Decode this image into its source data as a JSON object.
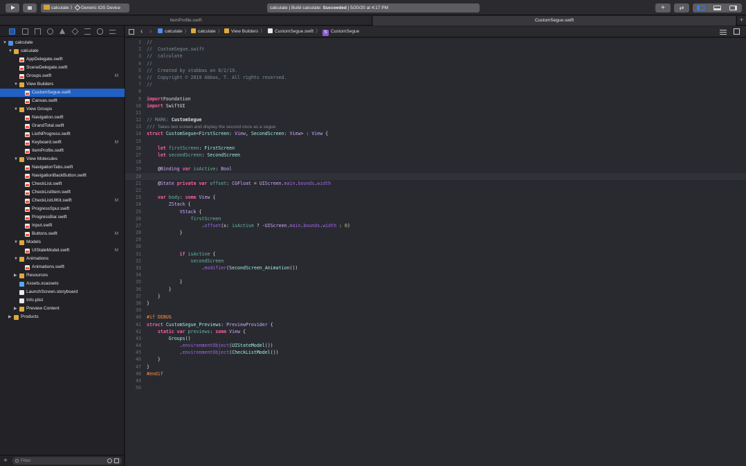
{
  "toolbar": {
    "scheme": "calculate",
    "destination": "Generic iOS Device",
    "activity_prefix": "calculate | Build calculate: ",
    "activity_status": "Succeeded",
    "activity_time": " | 5/20/20 at 4:17 PM",
    "add_label": "+",
    "swap_label": "⇄"
  },
  "tabs": [
    {
      "label": "ItemProfile.swift"
    },
    {
      "label": "CustomSegue.swift"
    }
  ],
  "tab_add": "+",
  "navigator": {
    "filter_placeholder": "Filter",
    "add_label": "+",
    "tree": [
      {
        "label": "calculate",
        "icon": "proj",
        "depth": 0,
        "disclosure": "▼",
        "badge": ""
      },
      {
        "label": "calculate",
        "icon": "folder",
        "depth": 1,
        "disclosure": "▼",
        "badge": ""
      },
      {
        "label": "AppDelegate.swift",
        "icon": "swift",
        "depth": 2,
        "disclosure": "",
        "badge": ""
      },
      {
        "label": "SceneDelegate.swift",
        "icon": "swift",
        "depth": 2,
        "disclosure": "",
        "badge": ""
      },
      {
        "label": "Groups.swift",
        "icon": "swift",
        "depth": 2,
        "disclosure": "",
        "badge": "M"
      },
      {
        "label": "View Builders",
        "icon": "folder",
        "depth": 2,
        "disclosure": "▼",
        "badge": ""
      },
      {
        "label": "CustomSegue.swift",
        "icon": "swift",
        "depth": 3,
        "disclosure": "",
        "badge": "",
        "selected": true
      },
      {
        "label": "Canvas.swift",
        "icon": "swift",
        "depth": 3,
        "disclosure": "",
        "badge": ""
      },
      {
        "label": "View Groups",
        "icon": "folder",
        "depth": 2,
        "disclosure": "▼",
        "badge": ""
      },
      {
        "label": "Navigation.swift",
        "icon": "swift",
        "depth": 3,
        "disclosure": "",
        "badge": ""
      },
      {
        "label": "GrandTotal.swift",
        "icon": "swift",
        "depth": 3,
        "disclosure": "",
        "badge": ""
      },
      {
        "label": "ListNProgress.swift",
        "icon": "swift",
        "depth": 3,
        "disclosure": "",
        "badge": ""
      },
      {
        "label": "Keyboard.swift",
        "icon": "swift",
        "depth": 3,
        "disclosure": "",
        "badge": "M"
      },
      {
        "label": "ItemProfile.swift",
        "icon": "swift",
        "depth": 3,
        "disclosure": "",
        "badge": ""
      },
      {
        "label": "View Molecules",
        "icon": "folder",
        "depth": 2,
        "disclosure": "▼",
        "badge": ""
      },
      {
        "label": "NavigationTabs.swift",
        "icon": "swift",
        "depth": 3,
        "disclosure": "",
        "badge": ""
      },
      {
        "label": "NavigationBackButton.swift",
        "icon": "swift",
        "depth": 3,
        "disclosure": "",
        "badge": ""
      },
      {
        "label": "CheckList.swift",
        "icon": "swift",
        "depth": 3,
        "disclosure": "",
        "badge": ""
      },
      {
        "label": "CheckListItem.swift",
        "icon": "swift",
        "depth": 3,
        "disclosure": "",
        "badge": ""
      },
      {
        "label": "CheckListUIKit.swift",
        "icon": "swift",
        "depth": 3,
        "disclosure": "",
        "badge": "M"
      },
      {
        "label": "ProgressSpur.swift",
        "icon": "swift",
        "depth": 3,
        "disclosure": "",
        "badge": ""
      },
      {
        "label": "ProgressBar.swift",
        "icon": "swift",
        "depth": 3,
        "disclosure": "",
        "badge": ""
      },
      {
        "label": "Input.swift",
        "icon": "swift",
        "depth": 3,
        "disclosure": "",
        "badge": ""
      },
      {
        "label": "Buttons.swift",
        "icon": "swift",
        "depth": 3,
        "disclosure": "",
        "badge": "M"
      },
      {
        "label": "Models",
        "icon": "folder",
        "depth": 2,
        "disclosure": "▼",
        "badge": ""
      },
      {
        "label": "UIStateModel.swift",
        "icon": "swift",
        "depth": 3,
        "disclosure": "",
        "badge": "M"
      },
      {
        "label": "Animations",
        "icon": "folder",
        "depth": 2,
        "disclosure": "▼",
        "badge": ""
      },
      {
        "label": "Animations.swift",
        "icon": "swift",
        "depth": 3,
        "disclosure": "",
        "badge": ""
      },
      {
        "label": "Resources",
        "icon": "folder",
        "depth": 2,
        "disclosure": "▶",
        "badge": ""
      },
      {
        "label": "Assets.xcassets",
        "icon": "assets",
        "depth": 2,
        "disclosure": "",
        "badge": ""
      },
      {
        "label": "LaunchScreen.storyboard",
        "icon": "file",
        "depth": 2,
        "disclosure": "",
        "badge": ""
      },
      {
        "label": "Info.plist",
        "icon": "file",
        "depth": 2,
        "disclosure": "",
        "badge": ""
      },
      {
        "label": "Preview Content",
        "icon": "folder",
        "depth": 2,
        "disclosure": "▶",
        "badge": ""
      },
      {
        "label": "Products",
        "icon": "folder",
        "depth": 1,
        "disclosure": "▶",
        "badge": ""
      }
    ]
  },
  "jumpbar": {
    "crumbs": [
      {
        "label": "calculate",
        "icon": "proj"
      },
      {
        "label": "calculate",
        "icon": "folder"
      },
      {
        "label": "View Builders",
        "icon": "folder"
      },
      {
        "label": "CustomSegue.swift",
        "icon": "swift"
      },
      {
        "label": "CustomSegue",
        "icon": "struct"
      }
    ],
    "struct_glyph": "S"
  },
  "editor": {
    "current_line": 20,
    "lines": [
      [
        [
          "cm",
          "//"
        ]
      ],
      [
        [
          "cm",
          "//  CustomSegue.swift"
        ]
      ],
      [
        [
          "cm",
          "//  calculate"
        ]
      ],
      [
        [
          "cm",
          "//"
        ]
      ],
      [
        [
          "cm",
          "//  Created by xtabbas on 8/2/19."
        ]
      ],
      [
        [
          "cm",
          "//  Copyright © 2019 Abbas, T. All rights reserved."
        ]
      ],
      [
        [
          "cm",
          "//"
        ]
      ],
      [],
      [
        [
          "kw",
          "import"
        ],
        [
          "",
          "Foundation"
        ]
      ],
      [
        [
          "kw",
          "import"
        ],
        [
          "",
          " SwiftUI"
        ]
      ],
      [],
      [
        [
          "cm",
          "// MARK: "
        ],
        [
          "mk",
          "CustomSegue"
        ]
      ],
      [
        [
          "cm",
          "/// "
        ],
        [
          "dc",
          "Takes two screen and display the second once as a segue"
        ]
      ],
      [
        [
          "kw",
          "struct"
        ],
        [
          "",
          " "
        ],
        [
          "pj",
          "CustomSegue"
        ],
        [
          "",
          "<"
        ],
        [
          "pj",
          "FirstScreen"
        ],
        [
          "",
          ": "
        ],
        [
          "ty",
          "View"
        ],
        [
          "",
          ", "
        ],
        [
          "pj",
          "SecondScreen"
        ],
        [
          "",
          ": "
        ],
        [
          "ty",
          "View"
        ],
        [
          "",
          "> : "
        ],
        [
          "ty",
          "View"
        ],
        [
          "",
          " {"
        ]
      ],
      [],
      [
        [
          "",
          "    "
        ],
        [
          "kw",
          "let"
        ],
        [
          "",
          " "
        ],
        [
          "pt",
          "firstScreen"
        ],
        [
          "",
          ": "
        ],
        [
          "pj",
          "FirstScreen"
        ]
      ],
      [
        [
          "",
          "    "
        ],
        [
          "kw",
          "let"
        ],
        [
          "",
          " "
        ],
        [
          "pt",
          "secondScreen"
        ],
        [
          "",
          ": "
        ],
        [
          "pj",
          "SecondScreen"
        ]
      ],
      [],
      [
        [
          "",
          "    @"
        ],
        [
          "ty",
          "Binding"
        ],
        [
          "",
          " "
        ],
        [
          "kw",
          "var"
        ],
        [
          "",
          " "
        ],
        [
          "pt",
          "isActive"
        ],
        [
          "",
          ": "
        ],
        [
          "ty",
          "Bool"
        ]
      ],
      [],
      [
        [
          "",
          "    @"
        ],
        [
          "ty",
          "State"
        ],
        [
          "",
          " "
        ],
        [
          "kw",
          "private var"
        ],
        [
          "",
          " "
        ],
        [
          "pt",
          "offset"
        ],
        [
          "",
          ": "
        ],
        [
          "ty",
          "CGFloat"
        ],
        [
          "",
          " = "
        ],
        [
          "ty",
          "UIScreen"
        ],
        [
          "",
          "."
        ],
        [
          "fn",
          "main"
        ],
        [
          "",
          "."
        ],
        [
          "fn",
          "bounds"
        ],
        [
          "",
          "."
        ],
        [
          "fn",
          "width"
        ]
      ],
      [],
      [
        [
          "",
          "    "
        ],
        [
          "kw",
          "var"
        ],
        [
          "",
          " "
        ],
        [
          "pt",
          "body"
        ],
        [
          "",
          ": "
        ],
        [
          "kw",
          "some"
        ],
        [
          "",
          " "
        ],
        [
          "ty",
          "View"
        ],
        [
          "",
          " {"
        ]
      ],
      [
        [
          "",
          "        "
        ],
        [
          "ty",
          "ZStack"
        ],
        [
          "",
          " {"
        ]
      ],
      [
        [
          "",
          "            "
        ],
        [
          "ty",
          "VStack"
        ],
        [
          "",
          " {"
        ]
      ],
      [
        [
          "",
          "                "
        ],
        [
          "pt",
          "firstScreen"
        ]
      ],
      [
        [
          "",
          "                    ."
        ],
        [
          "fn",
          "offset"
        ],
        [
          "",
          "(x: "
        ],
        [
          "pt",
          "isActive"
        ],
        [
          "",
          " ? -"
        ],
        [
          "ty",
          "UIScreen"
        ],
        [
          "",
          "."
        ],
        [
          "fn",
          "main"
        ],
        [
          "",
          "."
        ],
        [
          "fn",
          "bounds"
        ],
        [
          "",
          "."
        ],
        [
          "fn",
          "width"
        ],
        [
          "",
          " : "
        ],
        [
          "nm",
          "0"
        ],
        [
          "",
          ")"
        ]
      ],
      [
        [
          "",
          "            }"
        ]
      ],
      [],
      [],
      [
        [
          "",
          "            "
        ],
        [
          "kw",
          "if"
        ],
        [
          "",
          " "
        ],
        [
          "pt",
          "isActive"
        ],
        [
          "",
          " {"
        ]
      ],
      [
        [
          "",
          "                "
        ],
        [
          "pt",
          "secondScreen"
        ]
      ],
      [
        [
          "",
          "                    ."
        ],
        [
          "fn",
          "modifier"
        ],
        [
          "",
          "("
        ],
        [
          "pj",
          "SecondScreen_Animation"
        ],
        [
          "",
          "())"
        ]
      ],
      [],
      [
        [
          "",
          "            }"
        ]
      ],
      [
        [
          "",
          "        }"
        ]
      ],
      [
        [
          "",
          "    }"
        ]
      ],
      [
        [
          "",
          "}"
        ]
      ],
      [],
      [
        [
          "pp",
          "#if DEBUG"
        ]
      ],
      [
        [
          "kw",
          "struct"
        ],
        [
          "",
          " "
        ],
        [
          "pj",
          "CustomSegue_Previews"
        ],
        [
          "",
          ": "
        ],
        [
          "ty",
          "PreviewProvider"
        ],
        [
          "",
          " {"
        ]
      ],
      [
        [
          "",
          "    "
        ],
        [
          "kw",
          "static var"
        ],
        [
          "",
          " "
        ],
        [
          "pt",
          "previews"
        ],
        [
          "",
          ": "
        ],
        [
          "kw",
          "some"
        ],
        [
          "",
          " "
        ],
        [
          "ty",
          "View"
        ],
        [
          "",
          " {"
        ]
      ],
      [
        [
          "",
          "        "
        ],
        [
          "pj",
          "Groups"
        ],
        [
          "",
          "()"
        ]
      ],
      [
        [
          "",
          "            ."
        ],
        [
          "fn",
          "environmentObject"
        ],
        [
          "",
          "("
        ],
        [
          "pj",
          "UIStateModel"
        ],
        [
          "",
          "())"
        ]
      ],
      [
        [
          "",
          "            ."
        ],
        [
          "fn",
          "environmentObject"
        ],
        [
          "",
          "("
        ],
        [
          "pj",
          "CheckListModel"
        ],
        [
          "",
          "())"
        ]
      ],
      [
        [
          "",
          "    }"
        ]
      ],
      [
        [
          "",
          "}"
        ]
      ],
      [
        [
          "pp",
          "#endif"
        ]
      ],
      [],
      []
    ]
  }
}
